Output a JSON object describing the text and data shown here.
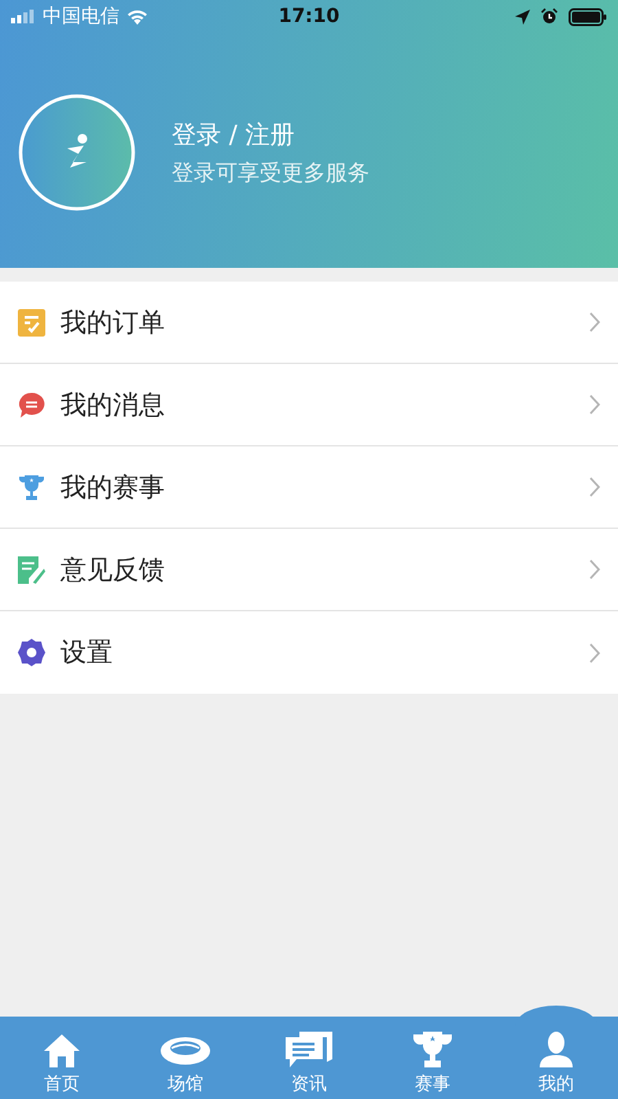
{
  "status_bar": {
    "carrier": "中国电信",
    "time": "17:10"
  },
  "profile": {
    "title": "登录 / 注册",
    "subtitle": "登录可享受更多服务"
  },
  "menu": [
    {
      "kind": "order",
      "label": "我的订单"
    },
    {
      "kind": "message",
      "label": "我的消息"
    },
    {
      "kind": "match",
      "label": "我的赛事"
    },
    {
      "kind": "feedback",
      "label": "意见反馈"
    },
    {
      "kind": "settings",
      "label": "设置"
    }
  ],
  "tabs": [
    {
      "kind": "home",
      "label": "首页",
      "selected": false
    },
    {
      "kind": "venue",
      "label": "场馆",
      "selected": false
    },
    {
      "kind": "news",
      "label": "资讯",
      "selected": false
    },
    {
      "kind": "match",
      "label": "赛事",
      "selected": false
    },
    {
      "kind": "me",
      "label": "我的",
      "selected": true
    }
  ]
}
